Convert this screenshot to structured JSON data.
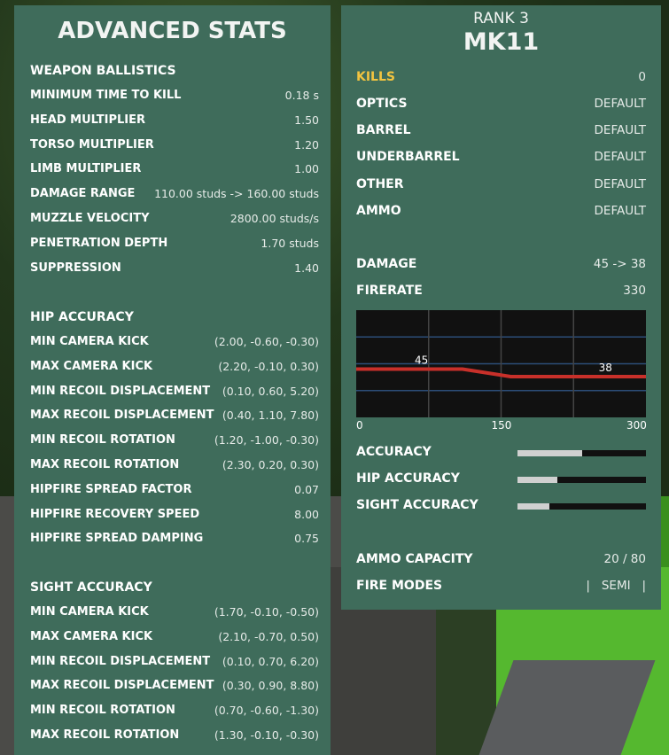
{
  "advanced": {
    "title": "ADVANCED STATS",
    "weapon_ballistics": {
      "heading": "WEAPON BALLISTICS",
      "rows": [
        {
          "label": "MINIMUM TIME TO KILL",
          "value": "0.18 s"
        },
        {
          "label": "HEAD MULTIPLIER",
          "value": "1.50"
        },
        {
          "label": "TORSO MULTIPLIER",
          "value": "1.20"
        },
        {
          "label": "LIMB MULTIPLIER",
          "value": "1.00"
        },
        {
          "label": "DAMAGE RANGE",
          "value": "110.00 studs -> 160.00 studs"
        },
        {
          "label": "MUZZLE VELOCITY",
          "value": "2800.00 studs/s"
        },
        {
          "label": "PENETRATION DEPTH",
          "value": "1.70 studs"
        },
        {
          "label": "SUPPRESSION",
          "value": "1.40"
        }
      ]
    },
    "hip_accuracy": {
      "heading": "HIP ACCURACY",
      "rows": [
        {
          "label": "MIN CAMERA KICK",
          "value": "(2.00, -0.60, -0.30)"
        },
        {
          "label": "MAX CAMERA KICK",
          "value": "(2.20, -0.10, 0.30)"
        },
        {
          "label": "MIN RECOIL DISPLACEMENT",
          "value": "(0.10, 0.60, 5.20)"
        },
        {
          "label": "MAX RECOIL DISPLACEMENT",
          "value": "(0.40, 1.10, 7.80)"
        },
        {
          "label": "MIN RECOIL ROTATION",
          "value": "(1.20, -1.00, -0.30)"
        },
        {
          "label": "MAX RECOIL ROTATION",
          "value": "(2.30, 0.20, 0.30)"
        },
        {
          "label": "HIPFIRE SPREAD FACTOR",
          "value": "0.07"
        },
        {
          "label": "HIPFIRE RECOVERY SPEED",
          "value": "8.00"
        },
        {
          "label": "HIPFIRE SPREAD DAMPING",
          "value": "0.75"
        }
      ]
    },
    "sight_accuracy": {
      "heading": "SIGHT ACCURACY",
      "rows": [
        {
          "label": "MIN CAMERA KICK",
          "value": "(1.70, -0.10, -0.50)"
        },
        {
          "label": "MAX CAMERA KICK",
          "value": "(2.10, -0.70, 0.50)"
        },
        {
          "label": "MIN RECOIL DISPLACEMENT",
          "value": "(0.10, 0.70, 6.20)"
        },
        {
          "label": "MAX RECOIL DISPLACEMENT",
          "value": "(0.30, 0.90, 8.80)"
        },
        {
          "label": "MIN RECOIL ROTATION",
          "value": "(0.70, -0.60, -1.30)"
        },
        {
          "label": "MAX RECOIL ROTATION",
          "value": "(1.30, -0.10, -0.30)"
        }
      ]
    }
  },
  "weapon": {
    "rank": "RANK 3",
    "name": "MK11",
    "kills": {
      "label": "KILLS",
      "value": "0"
    },
    "attachments": [
      {
        "label": "OPTICS",
        "value": "DEFAULT"
      },
      {
        "label": "BARREL",
        "value": "DEFAULT"
      },
      {
        "label": "UNDERBARREL",
        "value": "DEFAULT"
      },
      {
        "label": "OTHER",
        "value": "DEFAULT"
      },
      {
        "label": "AMMO",
        "value": "DEFAULT"
      }
    ],
    "damage": {
      "label": "DAMAGE",
      "value": "45 -> 38"
    },
    "firerate": {
      "label": "FIRERATE",
      "value": "330"
    },
    "accuracy_bars": [
      {
        "label": "ACCURACY",
        "fraction": 0.5
      },
      {
        "label": "HIP ACCURACY",
        "fraction": 0.31
      },
      {
        "label": "SIGHT ACCURACY",
        "fraction": 0.25
      }
    ],
    "ammo_capacity": {
      "label": "AMMO CAPACITY",
      "value": "20 / 80"
    },
    "fire_modes": {
      "label": "FIRE MODES",
      "value": "|   SEMI   |"
    }
  },
  "colors": {
    "panel": "#3f6c5b",
    "kills_label": "#f3c440",
    "damage_line": "#c8302a",
    "graph_bg": "#111111"
  },
  "chart_data": {
    "type": "line",
    "x": [
      0,
      110,
      160,
      300
    ],
    "series": [
      {
        "values": [
          45,
          45,
          38,
          38
        ]
      }
    ],
    "xticks": [
      "0",
      "150",
      "300"
    ],
    "annotations": [
      "45",
      "38"
    ],
    "xlim": [
      0,
      300
    ],
    "ylim": [
      0,
      100
    ],
    "grid": true
  }
}
